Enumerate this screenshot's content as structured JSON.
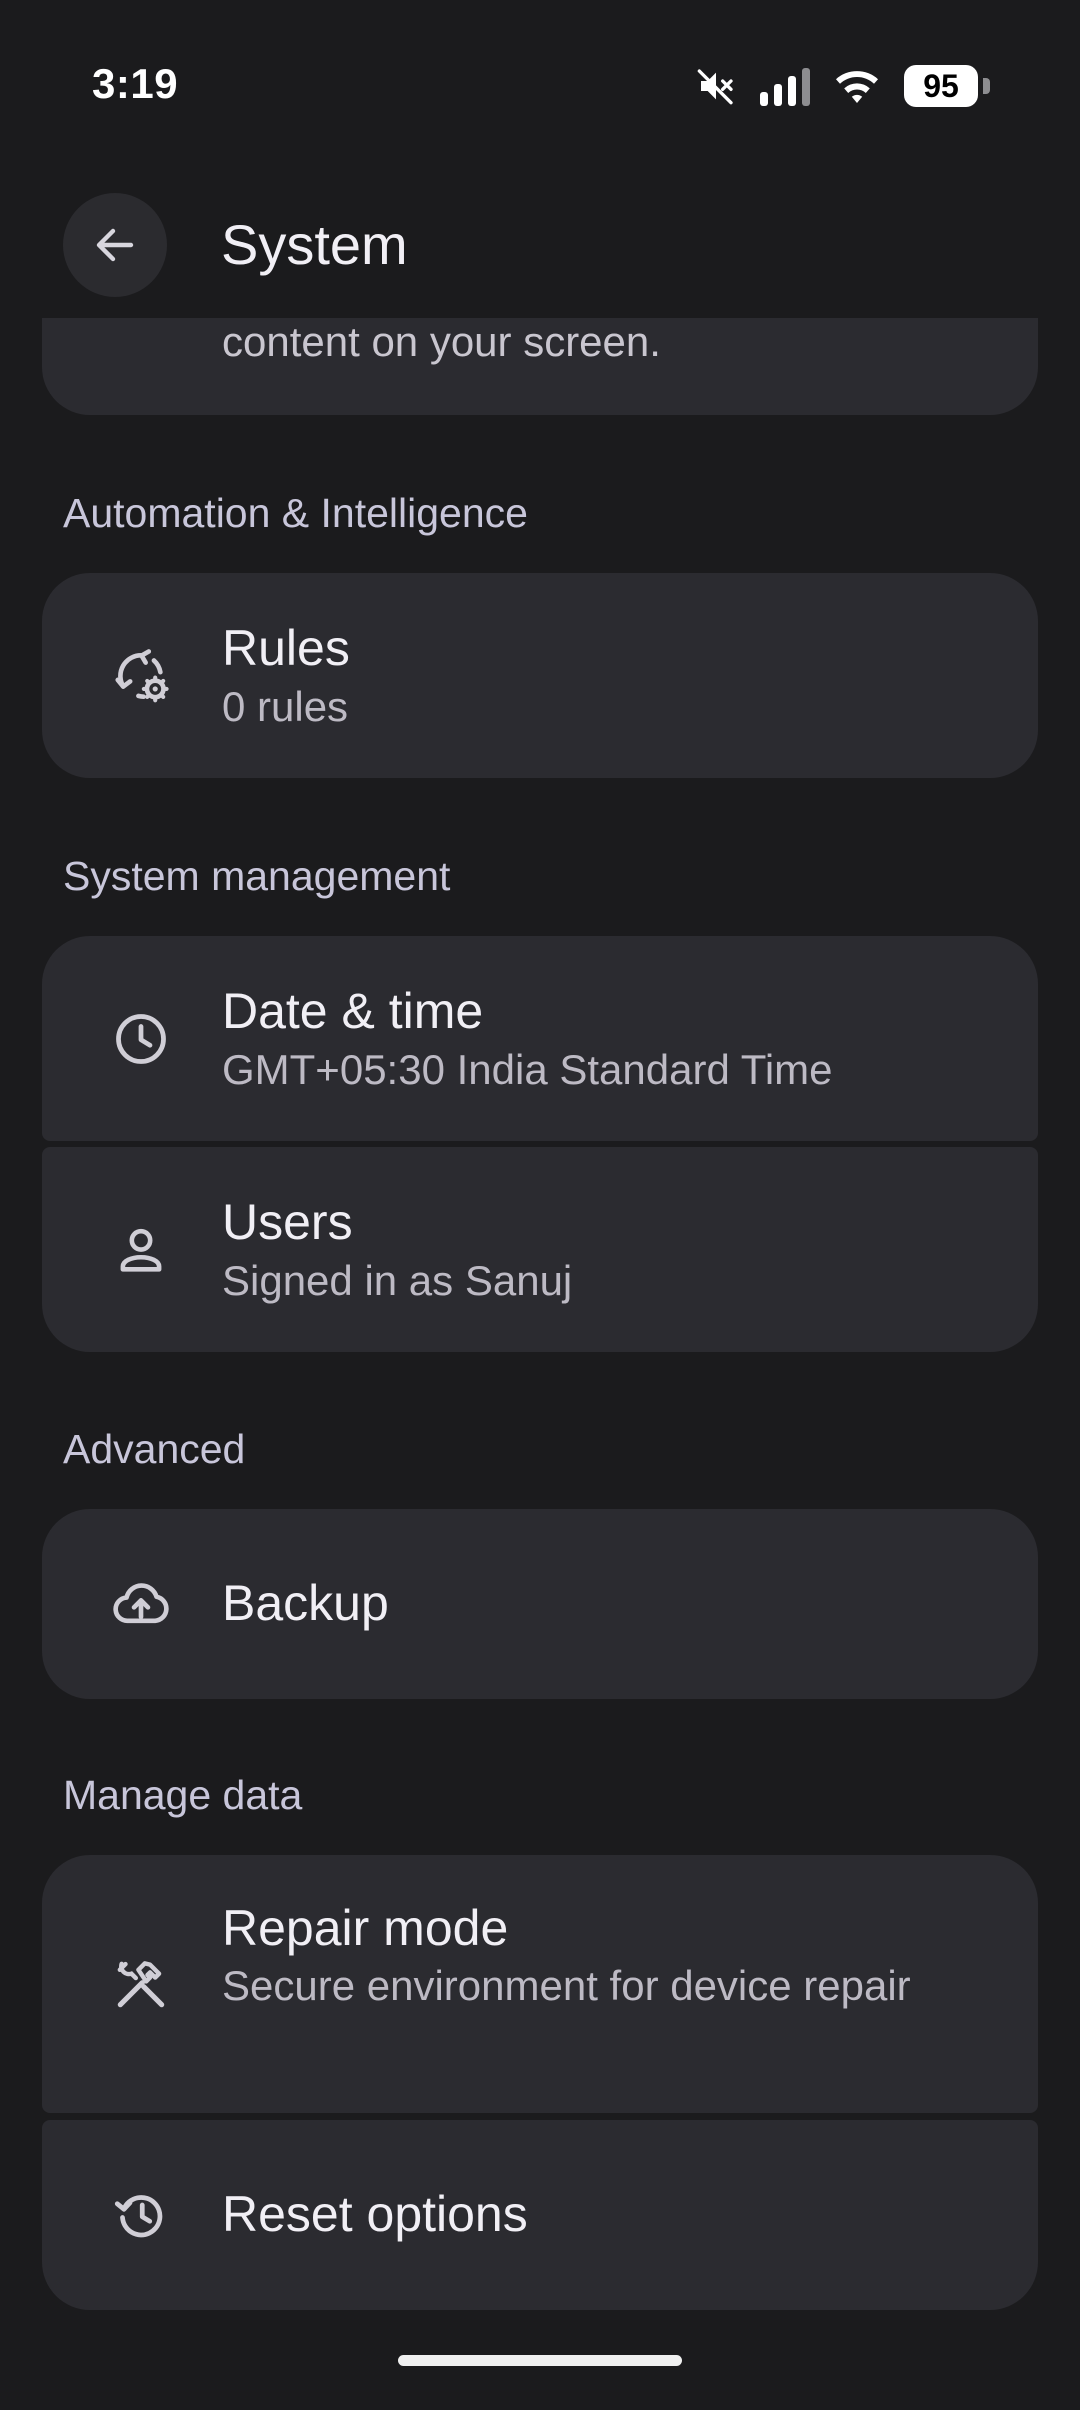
{
  "status_bar": {
    "time": "3:19",
    "battery_level": "95",
    "icons": [
      "mute-icon",
      "signal-icon",
      "wifi-icon",
      "battery-icon"
    ]
  },
  "app_bar": {
    "title": "System",
    "back_icon": "arrow-back-icon"
  },
  "partial_item": {
    "subtitle_fragment": "content on your screen."
  },
  "sections": {
    "automation": {
      "header": "Automation & Intelligence",
      "rules": {
        "title": "Rules",
        "subtitle": "0 rules",
        "icon": "rules-icon"
      }
    },
    "system_management": {
      "header": "System management",
      "date_time": {
        "title": "Date & time",
        "subtitle": "GMT+05:30 India Standard Time",
        "icon": "clock-icon"
      },
      "users": {
        "title": "Users",
        "subtitle": "Signed in as Sanuj",
        "icon": "person-icon"
      }
    },
    "advanced": {
      "header": "Advanced",
      "backup": {
        "title": "Backup",
        "icon": "cloud-upload-icon"
      }
    },
    "manage_data": {
      "header": "Manage data",
      "repair_mode": {
        "title": "Repair mode",
        "subtitle": "Secure environment for device repair",
        "icon": "repair-tools-icon"
      },
      "reset_options": {
        "title": "Reset options",
        "icon": "history-icon"
      }
    }
  },
  "colors": {
    "background": "#1b1b1d",
    "card": "#2b2b30",
    "section_header": "#c8c6da",
    "title_text": "#f1eff5",
    "subtitle_text": "#bdbac4"
  }
}
